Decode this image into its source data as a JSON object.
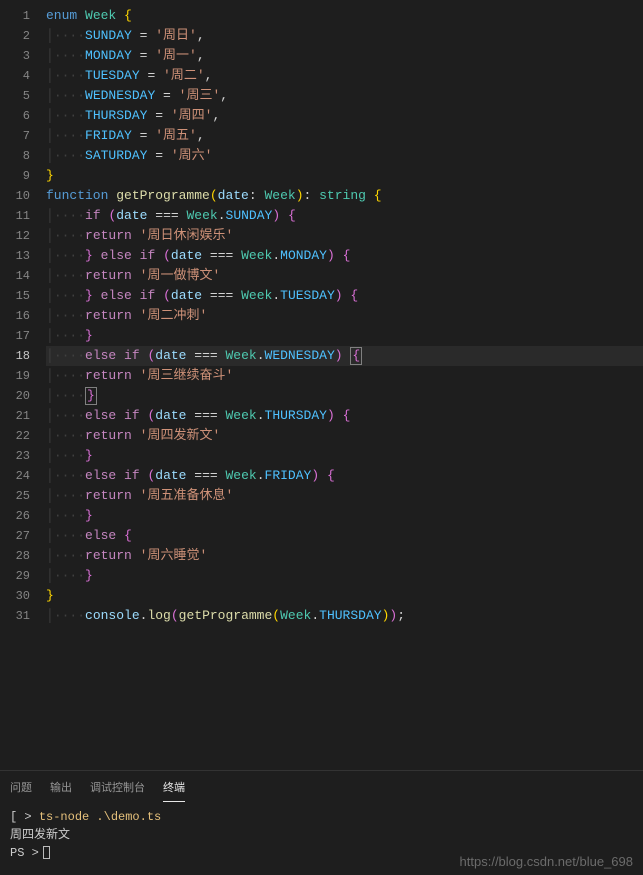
{
  "editor": {
    "active_line": 18,
    "line_count": 31,
    "lines": [
      {
        "n": 1,
        "tokens": [
          {
            "t": "enum ",
            "c": "kw"
          },
          {
            "t": "Week ",
            "c": "type"
          },
          {
            "t": "{",
            "c": "brace"
          }
        ]
      },
      {
        "n": 2,
        "indent": 1,
        "dots": 1,
        "tokens": [
          {
            "t": "SUNDAY",
            "c": "const"
          },
          {
            "t": " = ",
            "c": "punc"
          },
          {
            "t": "'周日'",
            "c": "str"
          },
          {
            "t": ",",
            "c": "punc"
          }
        ]
      },
      {
        "n": 3,
        "indent": 1,
        "dots": 1,
        "tokens": [
          {
            "t": "MONDAY",
            "c": "const"
          },
          {
            "t": " = ",
            "c": "punc"
          },
          {
            "t": "'周一'",
            "c": "str"
          },
          {
            "t": ",",
            "c": "punc"
          }
        ]
      },
      {
        "n": 4,
        "indent": 1,
        "dots": 1,
        "tokens": [
          {
            "t": "TUESDAY",
            "c": "const"
          },
          {
            "t": " = ",
            "c": "punc"
          },
          {
            "t": "'周二'",
            "c": "str"
          },
          {
            "t": ",",
            "c": "punc"
          }
        ]
      },
      {
        "n": 5,
        "indent": 1,
        "dots": 1,
        "tokens": [
          {
            "t": "WEDNESDAY",
            "c": "const"
          },
          {
            "t": " = ",
            "c": "punc"
          },
          {
            "t": "'周三'",
            "c": "str"
          },
          {
            "t": ",",
            "c": "punc"
          }
        ]
      },
      {
        "n": 6,
        "indent": 1,
        "dots": 1,
        "tokens": [
          {
            "t": "THURSDAY",
            "c": "const"
          },
          {
            "t": " = ",
            "c": "punc"
          },
          {
            "t": "'周四'",
            "c": "str"
          },
          {
            "t": ",",
            "c": "punc"
          }
        ]
      },
      {
        "n": 7,
        "indent": 1,
        "dots": 1,
        "tokens": [
          {
            "t": "FRIDAY",
            "c": "const"
          },
          {
            "t": " = ",
            "c": "punc"
          },
          {
            "t": "'周五'",
            "c": "str"
          },
          {
            "t": ",",
            "c": "punc"
          }
        ]
      },
      {
        "n": 8,
        "indent": 1,
        "dots": 1,
        "tokens": [
          {
            "t": "SATURDAY",
            "c": "const"
          },
          {
            "t": " = ",
            "c": "punc"
          },
          {
            "t": "'周六'",
            "c": "str"
          }
        ]
      },
      {
        "n": 9,
        "tokens": [
          {
            "t": "}",
            "c": "brace"
          }
        ]
      },
      {
        "n": 10,
        "tokens": [
          {
            "t": "function ",
            "c": "kw"
          },
          {
            "t": "getProgramme",
            "c": "fn"
          },
          {
            "t": "(",
            "c": "brace"
          },
          {
            "t": "date",
            "c": "var"
          },
          {
            "t": ": ",
            "c": "punc"
          },
          {
            "t": "Week",
            "c": "type"
          },
          {
            "t": ")",
            "c": "brace"
          },
          {
            "t": ": ",
            "c": "punc"
          },
          {
            "t": "string ",
            "c": "type"
          },
          {
            "t": "{",
            "c": "brace"
          }
        ]
      },
      {
        "n": 11,
        "indent": 1,
        "dots": 1,
        "tokens": [
          {
            "t": "if ",
            "c": "ctrl"
          },
          {
            "t": "(",
            "c": "brace2"
          },
          {
            "t": "date",
            "c": "var"
          },
          {
            "t": " === ",
            "c": "punc"
          },
          {
            "t": "Week",
            "c": "type"
          },
          {
            "t": ".",
            "c": "punc"
          },
          {
            "t": "SUNDAY",
            "c": "const"
          },
          {
            "t": ")",
            "c": "brace2"
          },
          {
            "t": " ",
            "c": "punc"
          },
          {
            "t": "{",
            "c": "brace2"
          }
        ]
      },
      {
        "n": 12,
        "indent": 1,
        "dots": 1,
        "tokens": [
          {
            "t": "return ",
            "c": "ctrl"
          },
          {
            "t": "'周日休闲娱乐'",
            "c": "str"
          }
        ]
      },
      {
        "n": 13,
        "indent": 1,
        "dots": 1,
        "tokens": [
          {
            "t": "}",
            "c": "brace2"
          },
          {
            "t": " ",
            "c": "punc"
          },
          {
            "t": "else if ",
            "c": "ctrl"
          },
          {
            "t": "(",
            "c": "brace2"
          },
          {
            "t": "date",
            "c": "var"
          },
          {
            "t": " === ",
            "c": "punc"
          },
          {
            "t": "Week",
            "c": "type"
          },
          {
            "t": ".",
            "c": "punc"
          },
          {
            "t": "MONDAY",
            "c": "const"
          },
          {
            "t": ")",
            "c": "brace2"
          },
          {
            "t": " ",
            "c": "punc"
          },
          {
            "t": "{",
            "c": "brace2"
          }
        ]
      },
      {
        "n": 14,
        "indent": 1,
        "dots": 1,
        "tokens": [
          {
            "t": "return ",
            "c": "ctrl"
          },
          {
            "t": "'周一做博文'",
            "c": "str"
          }
        ]
      },
      {
        "n": 15,
        "indent": 1,
        "dots": 1,
        "tokens": [
          {
            "t": "}",
            "c": "brace2"
          },
          {
            "t": " ",
            "c": "punc"
          },
          {
            "t": "else if ",
            "c": "ctrl"
          },
          {
            "t": "(",
            "c": "brace2"
          },
          {
            "t": "date",
            "c": "var"
          },
          {
            "t": " === ",
            "c": "punc"
          },
          {
            "t": "Week",
            "c": "type"
          },
          {
            "t": ".",
            "c": "punc"
          },
          {
            "t": "TUESDAY",
            "c": "const"
          },
          {
            "t": ")",
            "c": "brace2"
          },
          {
            "t": " ",
            "c": "punc"
          },
          {
            "t": "{",
            "c": "brace2"
          }
        ]
      },
      {
        "n": 16,
        "indent": 1,
        "dots": 1,
        "tokens": [
          {
            "t": "return ",
            "c": "ctrl"
          },
          {
            "t": "'周二冲刺'",
            "c": "str"
          }
        ]
      },
      {
        "n": 17,
        "indent": 1,
        "dots": 1,
        "tokens": [
          {
            "t": "}",
            "c": "brace2"
          }
        ]
      },
      {
        "n": 18,
        "indent": 1,
        "dots": 1,
        "active": true,
        "tokens": [
          {
            "t": "else if ",
            "c": "ctrl"
          },
          {
            "t": "(",
            "c": "brace2"
          },
          {
            "t": "date",
            "c": "var"
          },
          {
            "t": " === ",
            "c": "punc"
          },
          {
            "t": "Week",
            "c": "type"
          },
          {
            "t": ".",
            "c": "punc"
          },
          {
            "t": "WEDNESDAY",
            "c": "const"
          },
          {
            "t": ")",
            "c": "brace2"
          },
          {
            "t": " ",
            "c": "punc"
          },
          {
            "t": "{",
            "c": "brace2",
            "boxed": true
          }
        ]
      },
      {
        "n": 19,
        "indent": 1,
        "dots": 1,
        "tokens": [
          {
            "t": "return ",
            "c": "ctrl"
          },
          {
            "t": "'周三继续奋斗'",
            "c": "str"
          }
        ]
      },
      {
        "n": 20,
        "indent": 1,
        "dots": 1,
        "tokens": [
          {
            "t": "}",
            "c": "brace2",
            "boxed": true
          }
        ]
      },
      {
        "n": 21,
        "indent": 1,
        "dots": 1,
        "tokens": [
          {
            "t": "else if ",
            "c": "ctrl"
          },
          {
            "t": "(",
            "c": "brace2"
          },
          {
            "t": "date",
            "c": "var"
          },
          {
            "t": " === ",
            "c": "punc"
          },
          {
            "t": "Week",
            "c": "type"
          },
          {
            "t": ".",
            "c": "punc"
          },
          {
            "t": "THURSDAY",
            "c": "const"
          },
          {
            "t": ")",
            "c": "brace2"
          },
          {
            "t": " ",
            "c": "punc"
          },
          {
            "t": "{",
            "c": "brace2"
          }
        ]
      },
      {
        "n": 22,
        "indent": 1,
        "dots": 1,
        "tokens": [
          {
            "t": "return ",
            "c": "ctrl"
          },
          {
            "t": "'周四发新文'",
            "c": "str"
          }
        ]
      },
      {
        "n": 23,
        "indent": 1,
        "dots": 1,
        "tokens": [
          {
            "t": "}",
            "c": "brace2"
          }
        ]
      },
      {
        "n": 24,
        "indent": 1,
        "dots": 1,
        "tokens": [
          {
            "t": "else if ",
            "c": "ctrl"
          },
          {
            "t": "(",
            "c": "brace2"
          },
          {
            "t": "date",
            "c": "var"
          },
          {
            "t": " === ",
            "c": "punc"
          },
          {
            "t": "Week",
            "c": "type"
          },
          {
            "t": ".",
            "c": "punc"
          },
          {
            "t": "FRIDAY",
            "c": "const"
          },
          {
            "t": ")",
            "c": "brace2"
          },
          {
            "t": " ",
            "c": "punc"
          },
          {
            "t": "{",
            "c": "brace2"
          }
        ]
      },
      {
        "n": 25,
        "indent": 1,
        "dots": 1,
        "tokens": [
          {
            "t": "return ",
            "c": "ctrl"
          },
          {
            "t": "'周五准备休息'",
            "c": "str"
          }
        ]
      },
      {
        "n": 26,
        "indent": 1,
        "dots": 1,
        "tokens": [
          {
            "t": "}",
            "c": "brace2"
          }
        ]
      },
      {
        "n": 27,
        "indent": 1,
        "dots": 1,
        "tokens": [
          {
            "t": "else ",
            "c": "ctrl"
          },
          {
            "t": "{",
            "c": "brace2"
          }
        ]
      },
      {
        "n": 28,
        "indent": 1,
        "dots": 1,
        "tokens": [
          {
            "t": "return ",
            "c": "ctrl"
          },
          {
            "t": "'周六睡觉'",
            "c": "str"
          }
        ]
      },
      {
        "n": 29,
        "indent": 1,
        "dots": 1,
        "tokens": [
          {
            "t": "}",
            "c": "brace2"
          }
        ]
      },
      {
        "n": 30,
        "tokens": [
          {
            "t": "}",
            "c": "brace"
          }
        ]
      },
      {
        "n": 31,
        "indent": 1,
        "dots": 1,
        "tokens": [
          {
            "t": "console",
            "c": "var"
          },
          {
            "t": ".",
            "c": "punc"
          },
          {
            "t": "log",
            "c": "fn"
          },
          {
            "t": "(",
            "c": "brace2"
          },
          {
            "t": "getProgramme",
            "c": "fn"
          },
          {
            "t": "(",
            "c": "brace"
          },
          {
            "t": "Week",
            "c": "type"
          },
          {
            "t": ".",
            "c": "punc"
          },
          {
            "t": "THURSDAY",
            "c": "const"
          },
          {
            "t": ")",
            "c": "brace"
          },
          {
            "t": ")",
            "c": "brace2"
          },
          {
            "t": ";",
            "c": "punc"
          }
        ]
      }
    ]
  },
  "panel": {
    "tabs": [
      "问题",
      "输出",
      "调试控制台",
      "终端"
    ],
    "active_tab": "终端",
    "terminal_lines": [
      {
        "segments": [
          {
            "t": "[",
            "c": ""
          },
          {
            "t": "                          ",
            "c": "redact"
          },
          {
            "t": "> ",
            "c": ""
          },
          {
            "t": "ts-node .\\demo.ts",
            "c": "term-yellow"
          }
        ]
      },
      {
        "segments": [
          {
            "t": "周四发新文",
            "c": ""
          }
        ]
      },
      {
        "segments": [
          {
            "t": "PS ",
            "c": ""
          },
          {
            "t": "                         ",
            "c": "redact"
          },
          {
            "t": ">",
            "c": ""
          }
        ],
        "cursor": true
      }
    ]
  },
  "watermark": "https://blog.csdn.net/blue_698"
}
